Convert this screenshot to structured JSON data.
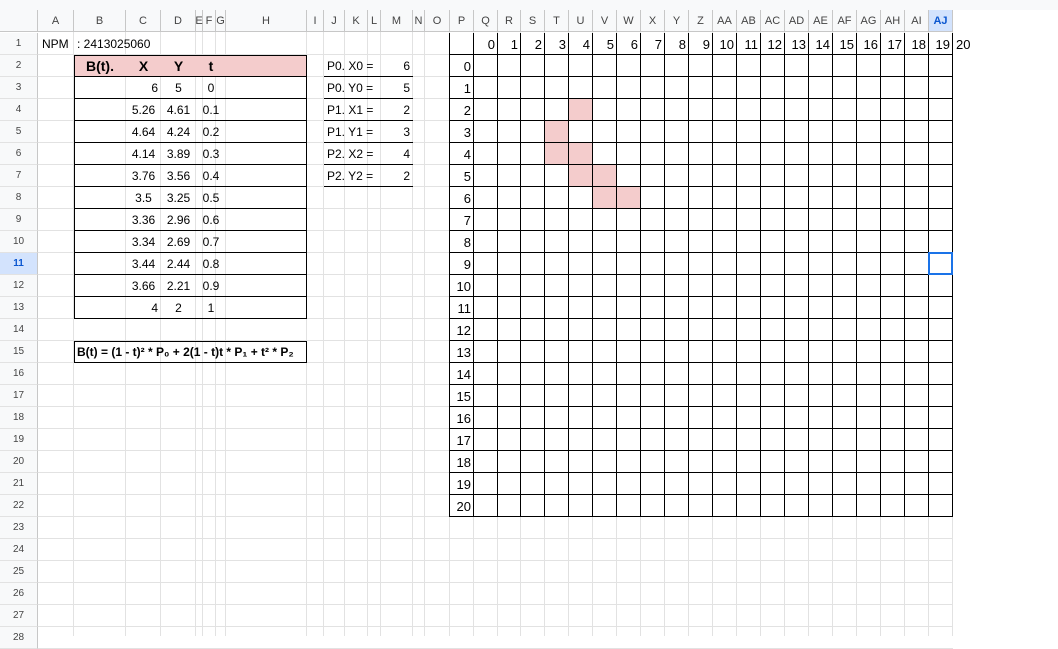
{
  "sheet": {
    "columns": [
      "A",
      "B",
      "C",
      "D",
      "E",
      "F",
      "G",
      "H",
      "I",
      "J",
      "K",
      "L",
      "M",
      "N",
      "O",
      "P",
      "Q",
      "R",
      "S",
      "T",
      "U",
      "V",
      "W",
      "X",
      "Y",
      "Z",
      "AA",
      "AB",
      "AC",
      "AD",
      "AE",
      "AF",
      "AG",
      "AH",
      "AI",
      "AJ"
    ],
    "rows": [
      "1",
      "2",
      "3",
      "4",
      "5",
      "6",
      "7",
      "8",
      "9",
      "10",
      "11",
      "12",
      "13",
      "14",
      "15",
      "16",
      "17",
      "18",
      "19",
      "20",
      "21",
      "22",
      "23",
      "24",
      "25",
      "26",
      "27",
      "28"
    ],
    "selected_column": "AJ",
    "selected_row": "11"
  },
  "npm": {
    "label": "NPM",
    "value": ": 2413025060"
  },
  "bezier_table": {
    "headers": [
      "B(t).",
      "X",
      "Y",
      "t"
    ],
    "rows": [
      [
        "6",
        "5",
        "0"
      ],
      [
        "5.26",
        "4.61",
        "0.1"
      ],
      [
        "4.64",
        "4.24",
        "0.2"
      ],
      [
        "4.14",
        "3.89",
        "0.3"
      ],
      [
        "3.76",
        "3.56",
        "0.4"
      ],
      [
        "3.5",
        "3.25",
        "0.5"
      ],
      [
        "3.36",
        "2.96",
        "0.6"
      ],
      [
        "3.34",
        "2.69",
        "0.7"
      ],
      [
        "3.44",
        "2.44",
        "0.8"
      ],
      [
        "3.66",
        "2.21",
        "0.9"
      ],
      [
        "4",
        "2",
        "1"
      ]
    ],
    "header_fill": "#f4cccc"
  },
  "formula": "B(t) = (1 - t)² * P₀ + 2(1 - t)t * P₁ + t² * P₂",
  "control_points": [
    {
      "label": "P0.  X0 =",
      "value": "6"
    },
    {
      "label": "P0.  Y0 =",
      "value": "5"
    },
    {
      "label": "P1.  X1 =",
      "value": "2"
    },
    {
      "label": "P1.  Y1 =",
      "value": "3"
    },
    {
      "label": "P2.  X2 =",
      "value": "4"
    },
    {
      "label": "P2.  Y2 =",
      "value": "2"
    }
  ],
  "grid": {
    "x_labels": [
      "0",
      "1",
      "2",
      "3",
      "4",
      "5",
      "6",
      "7",
      "8",
      "9",
      "10",
      "11",
      "12",
      "13",
      "14",
      "15",
      "16",
      "17",
      "18",
      "19",
      "20"
    ],
    "y_labels": [
      "0",
      "1",
      "2",
      "3",
      "4",
      "5",
      "6",
      "7",
      "8",
      "9",
      "10",
      "11",
      "12",
      "13",
      "14",
      "15",
      "16",
      "17",
      "18",
      "19",
      "20"
    ],
    "highlighted_cells": [
      [
        4,
        1
      ],
      [
        3,
        2
      ],
      [
        3,
        3
      ],
      [
        4,
        3
      ],
      [
        4,
        4
      ],
      [
        5,
        4
      ],
      [
        5,
        5
      ],
      [
        6,
        5
      ]
    ],
    "highlight_color": "#f4cccc"
  }
}
